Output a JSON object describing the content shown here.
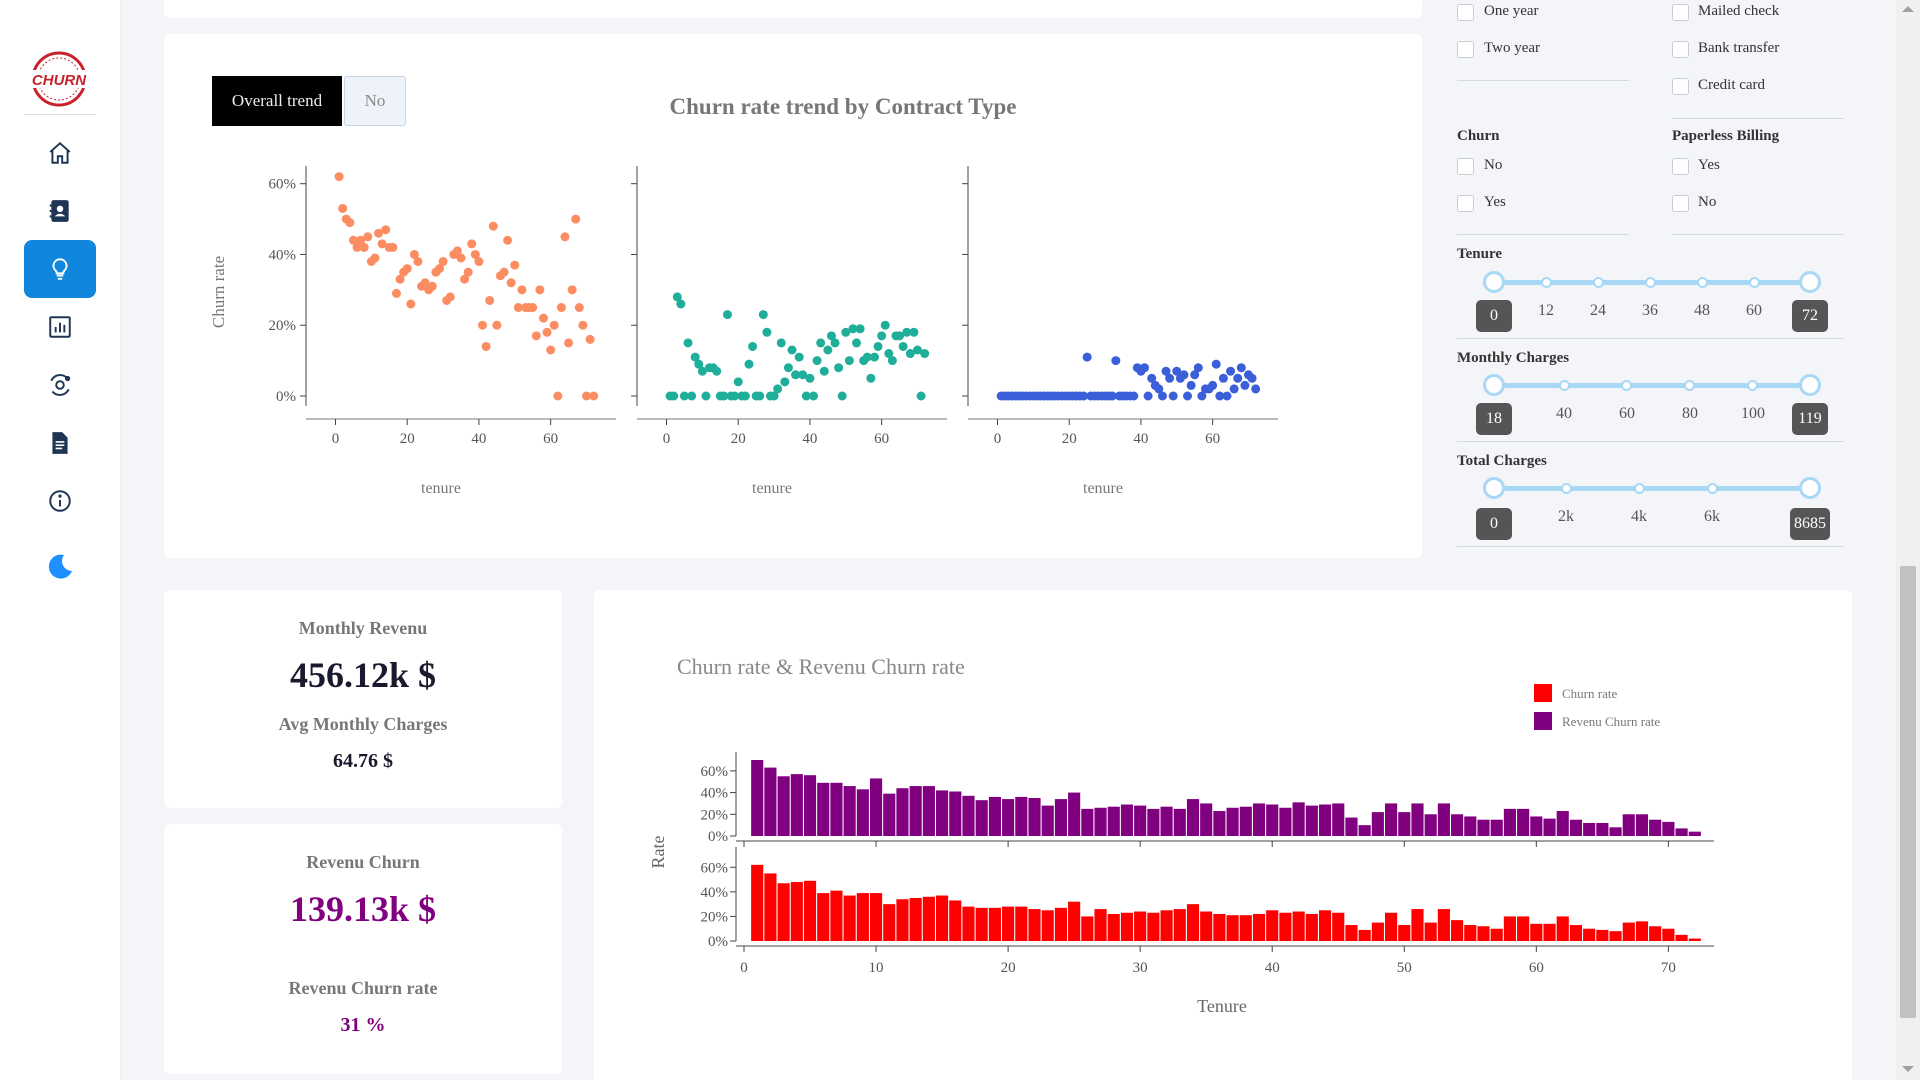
{
  "sidebar": {
    "logo_text": "CHURN",
    "items": [
      {
        "icon": "home-icon"
      },
      {
        "icon": "contact-book-icon"
      },
      {
        "icon": "lightbulb-icon",
        "active": true
      },
      {
        "icon": "bar-chart-icon"
      },
      {
        "icon": "orbit-icon"
      },
      {
        "icon": "document-icon"
      },
      {
        "icon": "info-icon"
      },
      {
        "icon": "moon-icon"
      }
    ]
  },
  "trend": {
    "overall_button": "Overall trend",
    "no_button": "No",
    "title": "Churn rate trend by Contract Type"
  },
  "filters": {
    "contract_options": [
      "One year",
      "Two year"
    ],
    "payment_options": [
      "Mailed check",
      "Bank transfer",
      "Credit card"
    ],
    "churn": {
      "title": "Churn",
      "options": [
        "No",
        "Yes"
      ]
    },
    "paperless": {
      "title": "Paperless Billing",
      "options": [
        "Yes",
        "No"
      ]
    },
    "tenure": {
      "title": "Tenure",
      "ticks": [
        "12",
        "24",
        "36",
        "48",
        "60"
      ],
      "min": "0",
      "max": "72"
    },
    "monthly": {
      "title": "Monthly Charges",
      "ticks": [
        "40",
        "60",
        "80",
        "100"
      ],
      "min": "18",
      "max": "119"
    },
    "total": {
      "title": "Total Charges",
      "ticks": [
        "2k",
        "4k",
        "6k"
      ],
      "min": "0",
      "max": "8685"
    }
  },
  "kpis": {
    "monthly_revenue_label": "Monthly Revenu",
    "monthly_revenue_value": "456.12k $",
    "avg_monthly_label": "Avg Monthly Charges",
    "avg_monthly_value": "64.76 $",
    "revenue_churn_label": "Revenu Churn",
    "revenue_churn_value": "139.13k $",
    "revenue_churn_rate_label": "Revenu Churn rate",
    "revenue_churn_rate_value": "31 %"
  },
  "colors": {
    "accent": "#1186dd",
    "month_to_month": "#fc8d62",
    "one_year": "#1fae9a",
    "two_year": "#3b5fd9",
    "churn_rate_bar": "#ff0000",
    "revenue_churn_bar": "#800080"
  },
  "chart_data": [
    {
      "type": "scatter",
      "title": "Churn rate trend by Contract Type",
      "ylabel": "Churn rate",
      "xlabel": "tenure",
      "ylim": [
        0,
        0.65
      ],
      "xlim": [
        -6,
        76
      ],
      "yticks": [
        "0%",
        "20%",
        "40%",
        "60%"
      ],
      "xticks": [
        "0",
        "20",
        "40",
        "60"
      ],
      "panels": [
        {
          "color": "#fc8d62",
          "x": [
            1,
            2,
            3,
            4,
            5,
            6,
            7,
            8,
            9,
            10,
            11,
            12,
            13,
            14,
            15,
            16,
            17,
            18,
            19,
            20,
            21,
            22,
            23,
            24,
            25,
            26,
            27,
            28,
            29,
            30,
            31,
            32,
            33,
            34,
            35,
            36,
            37,
            38,
            39,
            40,
            41,
            42,
            43,
            44,
            45,
            46,
            47,
            48,
            49,
            50,
            51,
            52,
            53,
            54,
            55,
            56,
            57,
            58,
            59,
            60,
            61,
            62,
            63,
            64,
            65,
            66,
            67,
            68,
            69,
            70,
            71,
            72
          ],
          "y": [
            0.62,
            0.53,
            0.5,
            0.49,
            0.44,
            0.42,
            0.44,
            0.42,
            0.45,
            0.38,
            0.39,
            0.46,
            0.43,
            0.47,
            0.42,
            0.42,
            0.29,
            0.33,
            0.35,
            0.36,
            0.26,
            0.4,
            0.38,
            0.31,
            0.32,
            0.3,
            0.31,
            0.35,
            0.36,
            0.38,
            0.27,
            0.28,
            0.4,
            0.41,
            0.39,
            0.33,
            0.35,
            0.43,
            0.4,
            0.38,
            0.2,
            0.14,
            0.27,
            0.48,
            0.2,
            0.34,
            0.35,
            0.44,
            0.32,
            0.37,
            0.25,
            0.3,
            0.25,
            0.25,
            0.25,
            0.17,
            0.3,
            0.22,
            0.18,
            0.13,
            0.2,
            0.0,
            0.25,
            0.45,
            0.15,
            0.3,
            0.5,
            0.25,
            0.2,
            0.0,
            0.16,
            0.0
          ]
        },
        {
          "color": "#1fae9a",
          "x": [
            1,
            2,
            3,
            4,
            5,
            6,
            7,
            8,
            9,
            10,
            11,
            12,
            13,
            14,
            15,
            16,
            17,
            18,
            19,
            20,
            21,
            22,
            23,
            24,
            25,
            26,
            27,
            28,
            29,
            30,
            31,
            32,
            33,
            34,
            35,
            36,
            37,
            38,
            39,
            40,
            41,
            42,
            43,
            44,
            45,
            46,
            47,
            48,
            49,
            50,
            51,
            52,
            53,
            54,
            55,
            56,
            57,
            58,
            59,
            60,
            61,
            62,
            63,
            64,
            65,
            66,
            67,
            68,
            69,
            70,
            71,
            72
          ],
          "y": [
            0.0,
            0.0,
            0.28,
            0.26,
            0.0,
            0.15,
            0.0,
            0.11,
            0.09,
            0.07,
            0.0,
            0.08,
            0.08,
            0.07,
            0.0,
            0.0,
            0.23,
            0.0,
            0.0,
            0.04,
            0.0,
            0.0,
            0.09,
            0.14,
            0.0,
            0.0,
            0.23,
            0.18,
            0.0,
            0.0,
            0.02,
            0.15,
            0.04,
            0.08,
            0.13,
            0.06,
            0.11,
            0.06,
            0.0,
            0.05,
            0.0,
            0.1,
            0.15,
            0.07,
            0.13,
            0.17,
            0.15,
            0.08,
            0.0,
            0.18,
            0.1,
            0.19,
            0.15,
            0.19,
            0.1,
            0.11,
            0.05,
            0.11,
            0.14,
            0.17,
            0.2,
            0.12,
            0.1,
            0.17,
            0.17,
            0.14,
            0.18,
            0.12,
            0.18,
            0.13,
            0.0,
            0.12
          ]
        },
        {
          "color": "#3b5fd9",
          "x": [
            1,
            2,
            3,
            4,
            5,
            6,
            7,
            8,
            9,
            10,
            11,
            12,
            13,
            14,
            15,
            16,
            17,
            18,
            19,
            20,
            21,
            22,
            23,
            24,
            25,
            26,
            27,
            28,
            29,
            30,
            31,
            32,
            33,
            34,
            35,
            36,
            37,
            38,
            39,
            40,
            41,
            42,
            43,
            44,
            45,
            46,
            47,
            48,
            49,
            50,
            51,
            52,
            53,
            54,
            55,
            56,
            57,
            58,
            59,
            60,
            61,
            62,
            63,
            64,
            65,
            66,
            67,
            68,
            69,
            70,
            71,
            72
          ],
          "y": [
            0,
            0,
            0,
            0,
            0,
            0,
            0,
            0,
            0,
            0,
            0,
            0,
            0,
            0,
            0,
            0,
            0,
            0,
            0,
            0,
            0,
            0,
            0,
            0,
            0.11,
            0,
            0,
            0,
            0,
            0,
            0,
            0,
            0.1,
            0,
            0,
            0,
            0,
            0,
            0.08,
            0.07,
            0.08,
            0,
            0.05,
            0.03,
            0.02,
            0,
            0.07,
            0.05,
            0,
            0.07,
            0.05,
            0.06,
            0,
            0.03,
            0.06,
            0.08,
            0,
            0.02,
            0.02,
            0.03,
            0.09,
            0,
            0.05,
            0,
            0.07,
            0.02,
            0.05,
            0.08,
            0.03,
            0.06,
            0.05,
            0.02
          ]
        }
      ]
    },
    {
      "type": "bar",
      "title": "Churn rate & Revenu Churn rate",
      "xlabel": "Tenure",
      "ylabel": "Rate",
      "ylim": [
        0,
        0.7
      ],
      "yticks": [
        "0%",
        "20%",
        "40%",
        "60%"
      ],
      "xticks": [
        "0",
        "10",
        "20",
        "30",
        "40",
        "50",
        "60",
        "70"
      ],
      "legend": "top-right",
      "categories": [
        1,
        2,
        3,
        4,
        5,
        6,
        7,
        8,
        9,
        10,
        11,
        12,
        13,
        14,
        15,
        16,
        17,
        18,
        19,
        20,
        21,
        22,
        23,
        24,
        25,
        26,
        27,
        28,
        29,
        30,
        31,
        32,
        33,
        34,
        35,
        36,
        37,
        38,
        39,
        40,
        41,
        42,
        43,
        44,
        45,
        46,
        47,
        48,
        49,
        50,
        51,
        52,
        53,
        54,
        55,
        56,
        57,
        58,
        59,
        60,
        61,
        62,
        63,
        64,
        65,
        66,
        67,
        68,
        69,
        70,
        71,
        72
      ],
      "series": [
        {
          "name": "Revenu Churn rate",
          "color": "#800080",
          "values": [
            0.7,
            0.63,
            0.55,
            0.57,
            0.56,
            0.49,
            0.49,
            0.46,
            0.43,
            0.53,
            0.39,
            0.44,
            0.46,
            0.46,
            0.42,
            0.41,
            0.37,
            0.33,
            0.36,
            0.34,
            0.36,
            0.35,
            0.28,
            0.34,
            0.4,
            0.25,
            0.26,
            0.27,
            0.29,
            0.28,
            0.25,
            0.27,
            0.25,
            0.34,
            0.3,
            0.23,
            0.26,
            0.27,
            0.3,
            0.29,
            0.26,
            0.31,
            0.28,
            0.29,
            0.3,
            0.17,
            0.1,
            0.22,
            0.3,
            0.22,
            0.3,
            0.2,
            0.3,
            0.2,
            0.18,
            0.15,
            0.15,
            0.25,
            0.25,
            0.18,
            0.16,
            0.23,
            0.15,
            0.12,
            0.12,
            0.08,
            0.2,
            0.2,
            0.15,
            0.13,
            0.07,
            0.04
          ]
        },
        {
          "name": "Churn rate",
          "color": "#ff0000",
          "values": [
            0.62,
            0.55,
            0.47,
            0.48,
            0.49,
            0.39,
            0.41,
            0.37,
            0.39,
            0.39,
            0.3,
            0.34,
            0.35,
            0.36,
            0.37,
            0.33,
            0.28,
            0.27,
            0.27,
            0.28,
            0.28,
            0.26,
            0.25,
            0.27,
            0.32,
            0.2,
            0.26,
            0.22,
            0.23,
            0.24,
            0.23,
            0.25,
            0.26,
            0.3,
            0.24,
            0.22,
            0.21,
            0.21,
            0.22,
            0.25,
            0.23,
            0.24,
            0.22,
            0.25,
            0.23,
            0.13,
            0.09,
            0.15,
            0.23,
            0.13,
            0.26,
            0.15,
            0.26,
            0.17,
            0.13,
            0.12,
            0.1,
            0.2,
            0.2,
            0.14,
            0.14,
            0.2,
            0.13,
            0.1,
            0.09,
            0.08,
            0.15,
            0.16,
            0.12,
            0.1,
            0.05,
            0.02
          ]
        }
      ]
    }
  ]
}
